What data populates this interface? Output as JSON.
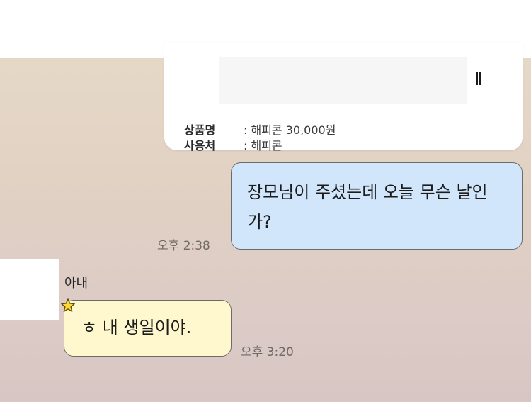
{
  "gift_card": {
    "product_label": "상품명",
    "product_value": ": 해피콘 30,000원",
    "store_label": "사용처",
    "store_value": ": 해피콘"
  },
  "messages": [
    {
      "sender": "me",
      "text": "장모님이 주셨는데 오늘 무슨 날인가?",
      "time": "오후 2:38"
    },
    {
      "sender": "아내",
      "text": "ㅎ 내 생일이야.",
      "time": "오후 3:20"
    }
  ],
  "colors": {
    "my_bubble": "#d2e6fb",
    "their_bubble": "#fff8cf",
    "chat_background": "#e3d4c6"
  },
  "icons": {
    "star": "star-icon"
  }
}
